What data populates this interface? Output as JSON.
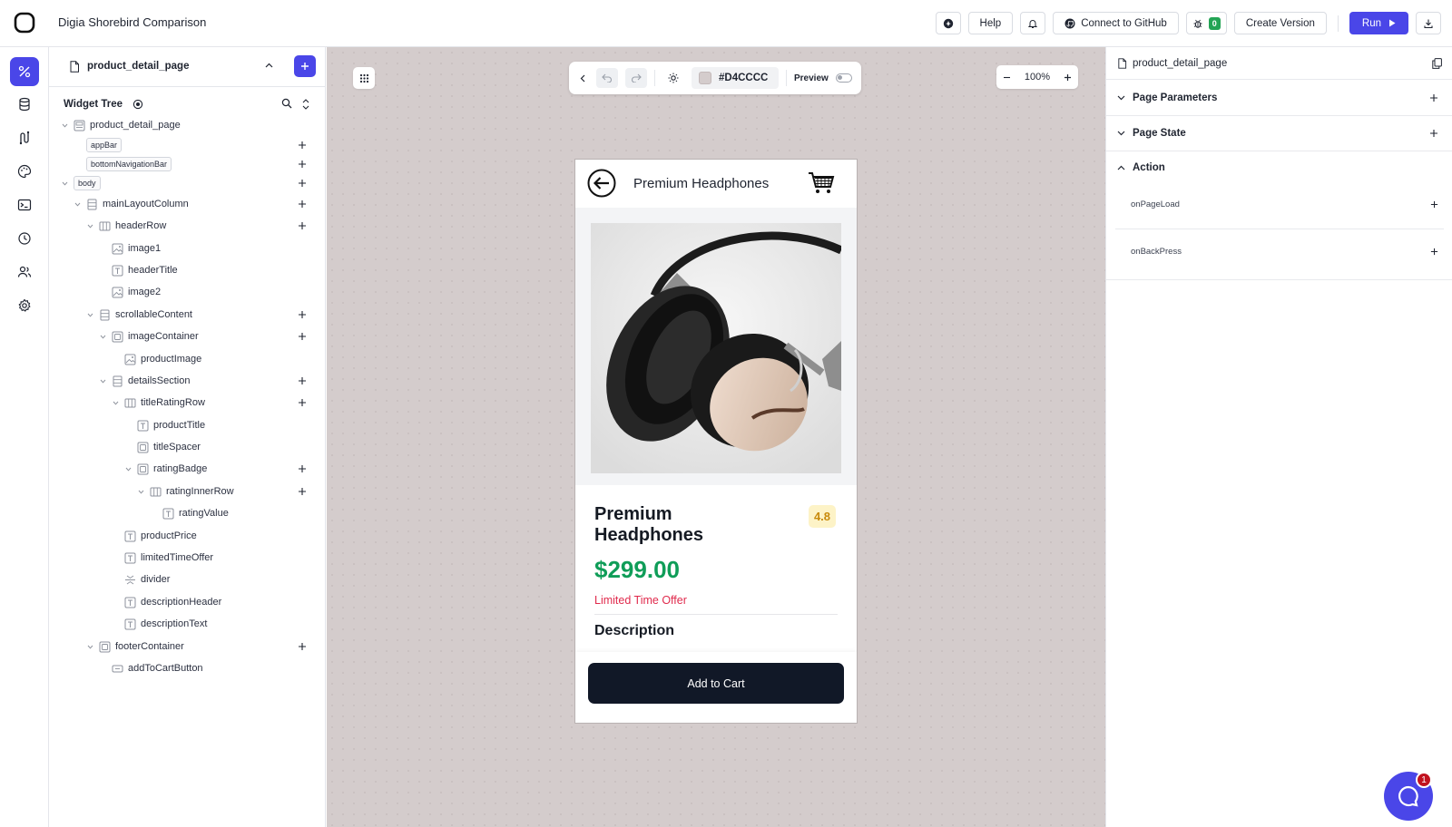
{
  "topbar": {
    "app_title": "Digia Shorebird Comparison",
    "help_label": "Help",
    "github_label": "Connect to GitHub",
    "bug_count": "0",
    "create_version_label": "Create Version",
    "run_label": "Run"
  },
  "rail": {
    "items": [
      "design-icon",
      "database-icon",
      "api-icon",
      "palette-icon",
      "terminal-icon",
      "history-icon",
      "users-icon",
      "settings-icon"
    ],
    "accent": "#4a46e8"
  },
  "tree_panel": {
    "page_name": "product_detail_page",
    "widget_tree_label": "Widget Tree",
    "nodes": [
      {
        "label": "product_detail_page",
        "kind": "scaffold"
      },
      {
        "label": "appBar",
        "kind": "tag"
      },
      {
        "label": "bottomNavigationBar",
        "kind": "tag"
      },
      {
        "label": "body",
        "kind": "tag"
      },
      {
        "label": "mainLayoutColumn",
        "kind": "column"
      },
      {
        "label": "headerRow",
        "kind": "row"
      },
      {
        "label": "image1",
        "kind": "image"
      },
      {
        "label": "headerTitle",
        "kind": "text"
      },
      {
        "label": "image2",
        "kind": "image"
      },
      {
        "label": "scrollableContent",
        "kind": "column"
      },
      {
        "label": "imageContainer",
        "kind": "container"
      },
      {
        "label": "productImage",
        "kind": "image"
      },
      {
        "label": "detailsSection",
        "kind": "column"
      },
      {
        "label": "titleRatingRow",
        "kind": "row"
      },
      {
        "label": "productTitle",
        "kind": "text"
      },
      {
        "label": "titleSpacer",
        "kind": "container"
      },
      {
        "label": "ratingBadge",
        "kind": "container"
      },
      {
        "label": "ratingInnerRow",
        "kind": "row"
      },
      {
        "label": "ratingValue",
        "kind": "text"
      },
      {
        "label": "productPrice",
        "kind": "text"
      },
      {
        "label": "limitedTimeOffer",
        "kind": "text"
      },
      {
        "label": "divider",
        "kind": "divider"
      },
      {
        "label": "descriptionHeader",
        "kind": "text"
      },
      {
        "label": "descriptionText",
        "kind": "text"
      },
      {
        "label": "footerContainer",
        "kind": "container"
      },
      {
        "label": "addToCartButton",
        "kind": "button"
      }
    ]
  },
  "canvas": {
    "background_color": "#D4CCCC",
    "preview_label": "Preview",
    "zoom": "100%"
  },
  "phone": {
    "header_title": "Premium Headphones",
    "product_title": "Premium Headphones",
    "rating": "4.8",
    "price": "$299.00",
    "offer": "Limited Time Offer",
    "description_header": "Description",
    "cta_label": "Add to Cart",
    "price_color": "#0f9d58",
    "offer_color": "#e02a4c"
  },
  "right_panel": {
    "page_name": "product_detail_page",
    "page_parameters_label": "Page Parameters",
    "page_state_label": "Page State",
    "action_label": "Action",
    "actions": [
      "onPageLoad",
      "onBackPress"
    ]
  },
  "chat": {
    "badge_count": "1"
  }
}
